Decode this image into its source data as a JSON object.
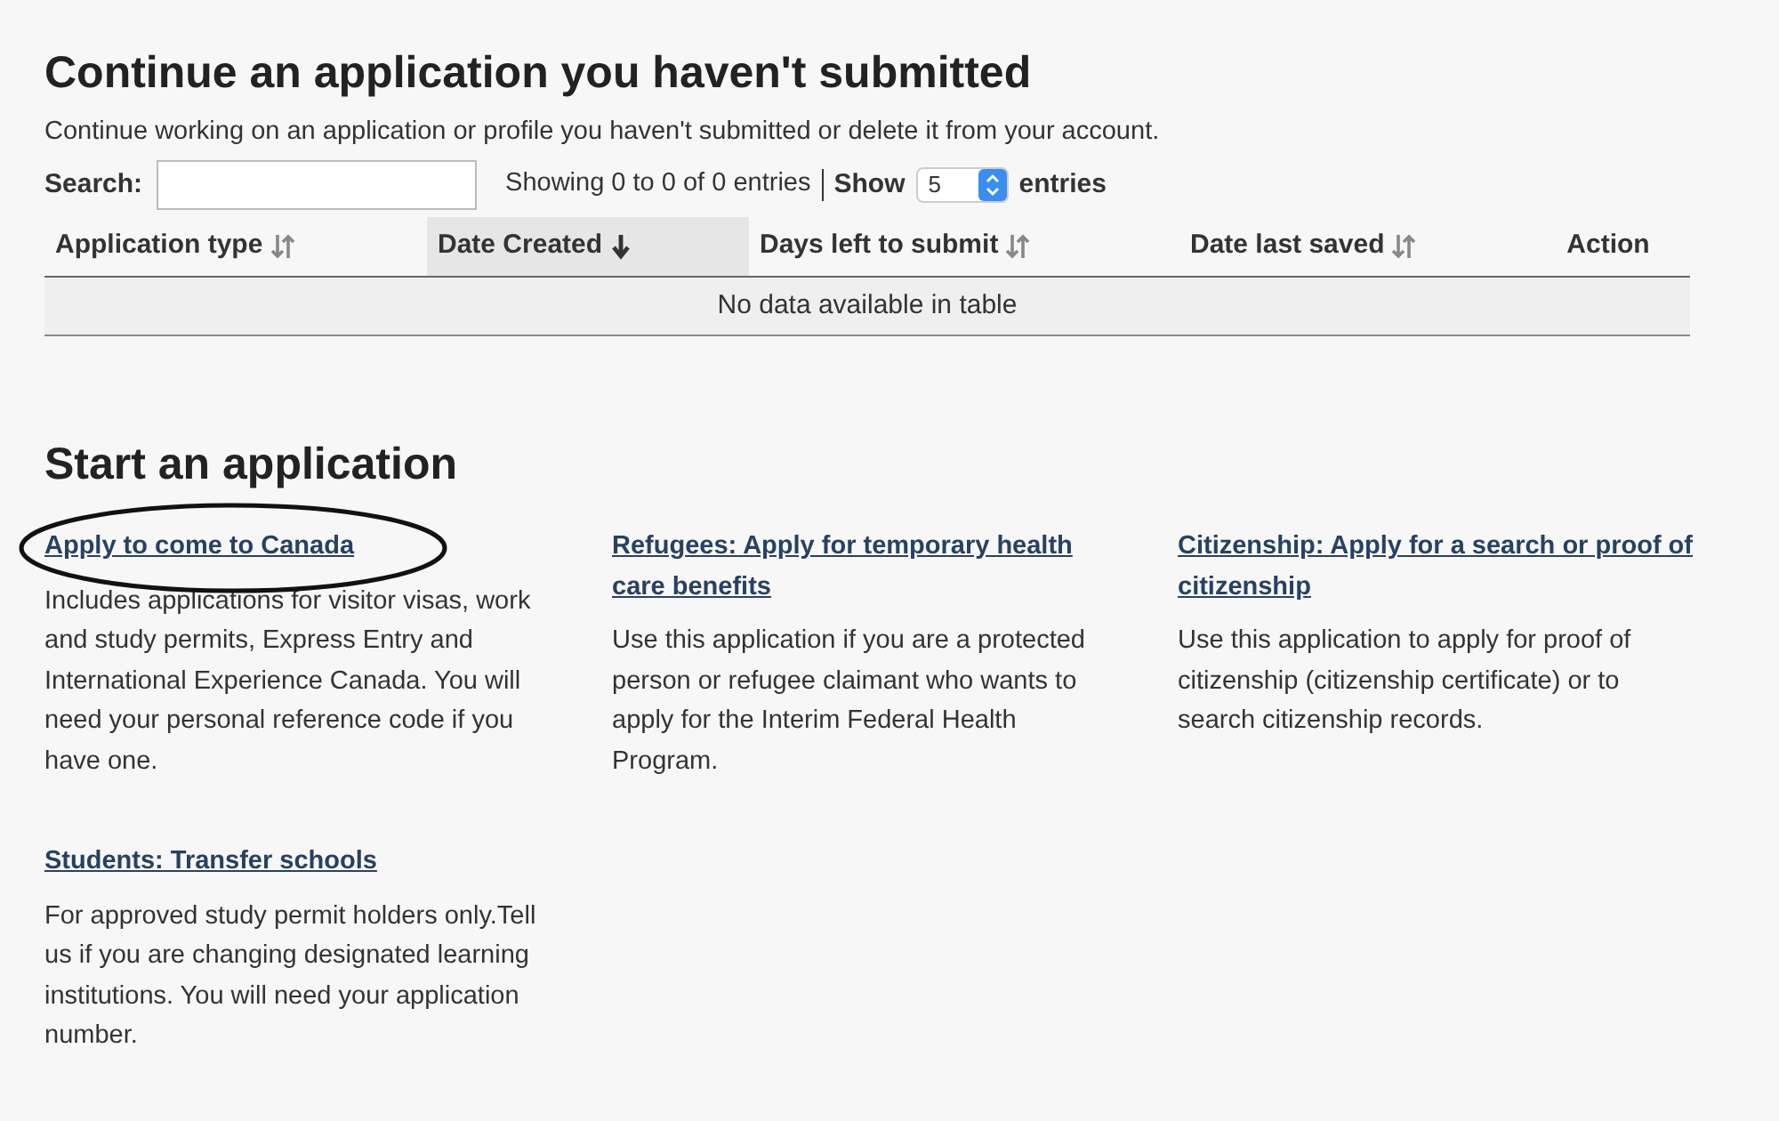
{
  "continue_section": {
    "title": "Continue an application you haven't submitted",
    "description": "Continue working on an application or profile you haven't submitted or delete it from your account.",
    "search": {
      "label": "Search:"
    },
    "info": "Showing 0 to 0 of 0 entries",
    "show_label": "Show",
    "page_size": "5",
    "entries_label": "entries",
    "table": {
      "columns": [
        {
          "label": "Application type",
          "kind": "sortable",
          "selected": false
        },
        {
          "label": "Date Created",
          "kind": "sorted",
          "selected": true
        },
        {
          "label": "Days left to submit",
          "kind": "sortable",
          "selected": false
        },
        {
          "label": "Date last saved",
          "kind": "sortable",
          "selected": false
        },
        {
          "label": "Action",
          "kind": "plain",
          "selected": false
        }
      ],
      "empty_message": "No data available in table"
    }
  },
  "start_section": {
    "title": "Start an application",
    "cards": [
      {
        "link": "Apply to come to Canada",
        "description": "Includes applications for visitor visas, work and study permits, Express Entry and International Experience Canada. You will need your personal reference code if you have one.",
        "circled": true
      },
      {
        "link": "Refugees: Apply for temporary health care benefits",
        "description": "Use this application if you are a protected person or refugee claimant who wants to apply for the Interim Federal Health Program.",
        "circled": false
      },
      {
        "link": "Citizenship: Apply for a search or proof of citizenship ",
        "description": "Use this application to apply for proof of citizenship (citizenship certificate) or to search citizenship records.",
        "circled": false
      },
      {
        "link": "Students: Transfer schools",
        "description": "For approved study permit holders only.Tell us if you are changing designated learning institutions. You will need your application number.",
        "circled": false
      }
    ]
  }
}
